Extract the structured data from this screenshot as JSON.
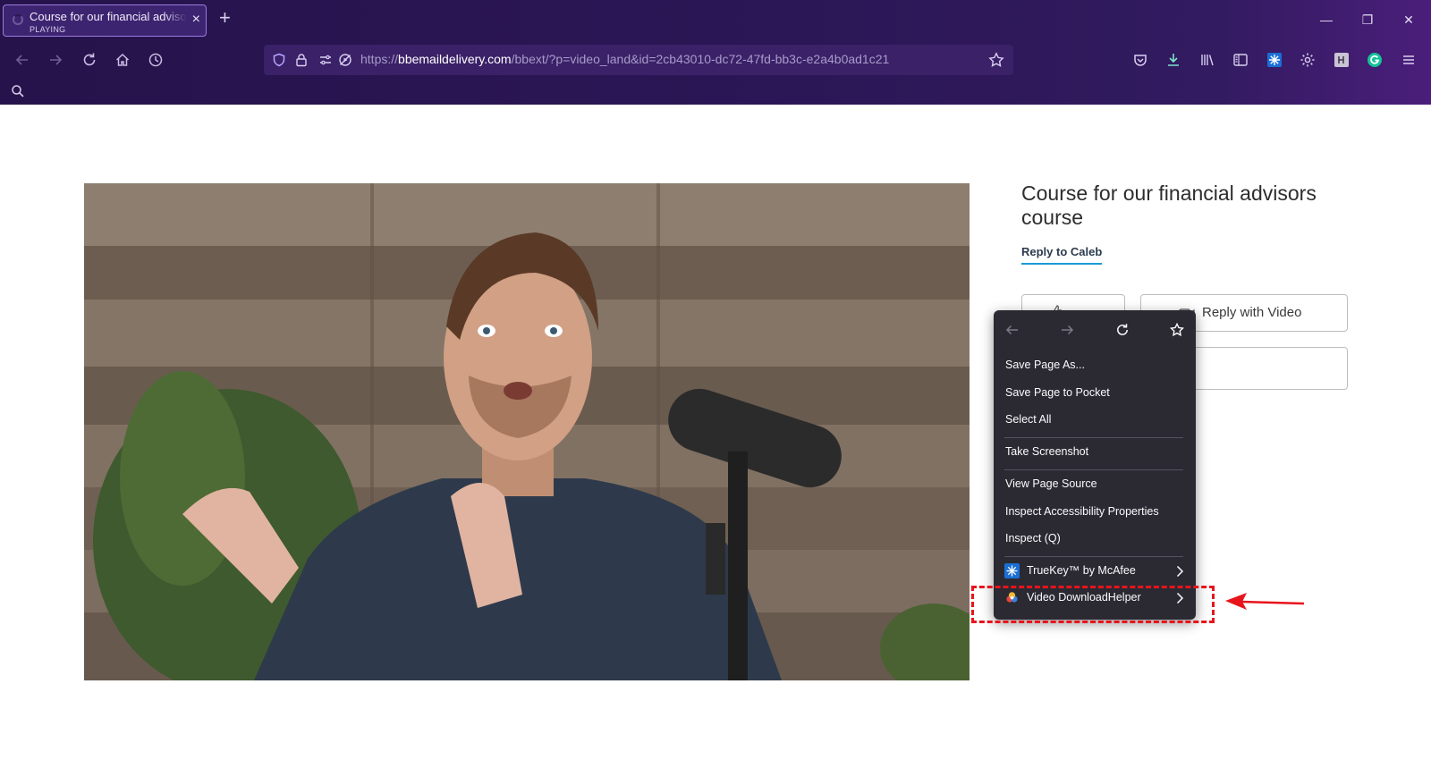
{
  "tab": {
    "title": "Course for our financial advisors course",
    "status": "PLAYING"
  },
  "urlbar": {
    "url_prefix": "https://",
    "url_domain": "bbemaildelivery.com",
    "url_path": "/bbext/?p=video_land&id=2cb43010-dc72-47fd-bb3c-e2a4b0ad1c21"
  },
  "page": {
    "title": "Course for our financial advisors course",
    "reply_link": "Reply to Caleb",
    "reply_video_label": "Reply with Video"
  },
  "context_menu": {
    "items": [
      {
        "label": "Save Page As...",
        "group": 1
      },
      {
        "label": "Save Page to Pocket",
        "group": 1
      },
      {
        "label": "Select All",
        "group": 1
      },
      {
        "label": "Take Screenshot",
        "group": 2
      },
      {
        "label": "View Page Source",
        "group": 3
      },
      {
        "label": "Inspect Accessibility Properties",
        "group": 3
      },
      {
        "label": "Inspect (Q)",
        "group": 3
      }
    ],
    "submenus": [
      {
        "label": "TrueKey™ by McAfee",
        "icon": "truekey-icon"
      },
      {
        "label": "Video DownloadHelper",
        "icon": "video-downloadhelper-icon"
      }
    ]
  },
  "colors": {
    "annotation": "#e8141c",
    "accent": "#1a9ad6",
    "chrome": "#2c1757"
  }
}
